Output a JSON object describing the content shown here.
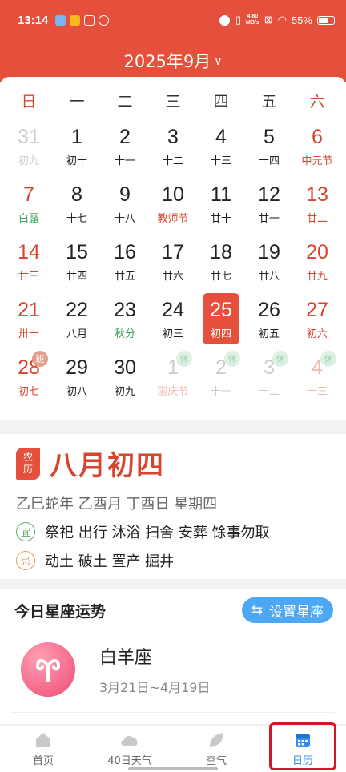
{
  "status_bar": {
    "time": "13:14",
    "net_speed_value": "4.80",
    "net_speed_unit": "MB/s",
    "battery": "55%"
  },
  "header": {
    "title": "2025年9月",
    "chevron_icon": "chevron-down-icon"
  },
  "weekdays": [
    "日",
    "一",
    "二",
    "三",
    "四",
    "五",
    "六"
  ],
  "calendar": {
    "selected": "25",
    "rows": [
      [
        {
          "d": "31",
          "l": "初九",
          "s": "dim"
        },
        {
          "d": "1",
          "l": "初十",
          "s": ""
        },
        {
          "d": "2",
          "l": "十一",
          "s": ""
        },
        {
          "d": "3",
          "l": "十二",
          "s": ""
        },
        {
          "d": "4",
          "l": "十三",
          "s": ""
        },
        {
          "d": "5",
          "l": "十四",
          "s": ""
        },
        {
          "d": "6",
          "l": "中元节",
          "s": "red"
        }
      ],
      [
        {
          "d": "7",
          "l": "白露",
          "s": "red-term"
        },
        {
          "d": "8",
          "l": "十七",
          "s": ""
        },
        {
          "d": "9",
          "l": "十八",
          "s": ""
        },
        {
          "d": "10",
          "l": "教师节",
          "s": "fest"
        },
        {
          "d": "11",
          "l": "廿十",
          "s": ""
        },
        {
          "d": "12",
          "l": "廿一",
          "s": ""
        },
        {
          "d": "13",
          "l": "廿二",
          "s": "red"
        }
      ],
      [
        {
          "d": "14",
          "l": "廿三",
          "s": "red"
        },
        {
          "d": "15",
          "l": "廿四",
          "s": ""
        },
        {
          "d": "16",
          "l": "廿五",
          "s": ""
        },
        {
          "d": "17",
          "l": "廿六",
          "s": ""
        },
        {
          "d": "18",
          "l": "廿七",
          "s": ""
        },
        {
          "d": "19",
          "l": "廿八",
          "s": ""
        },
        {
          "d": "20",
          "l": "廿九",
          "s": "red"
        }
      ],
      [
        {
          "d": "21",
          "l": "卅十",
          "s": "red"
        },
        {
          "d": "22",
          "l": "八月",
          "s": ""
        },
        {
          "d": "23",
          "l": "秋分",
          "s": "term"
        },
        {
          "d": "24",
          "l": "初三",
          "s": ""
        },
        {
          "d": "25",
          "l": "初四",
          "s": "selected"
        },
        {
          "d": "26",
          "l": "初五",
          "s": ""
        },
        {
          "d": "27",
          "l": "初六",
          "s": "red"
        }
      ],
      [
        {
          "d": "28",
          "l": "初七",
          "s": "red",
          "b": "班"
        },
        {
          "d": "29",
          "l": "初八",
          "s": ""
        },
        {
          "d": "30",
          "l": "初九",
          "s": ""
        },
        {
          "d": "1",
          "l": "国庆节",
          "s": "dimfest",
          "b": "休"
        },
        {
          "d": "2",
          "l": "十一",
          "s": "dim",
          "b": "休"
        },
        {
          "d": "3",
          "l": "十二",
          "s": "dim",
          "b": "休"
        },
        {
          "d": "4",
          "l": "十三",
          "s": "dimred",
          "b": "休"
        }
      ]
    ]
  },
  "lunar_info": {
    "tag": "农历",
    "date": "八月初四",
    "ganzhi": "乙巳蛇年 乙酉月 丁酉日 星期四",
    "yi_label": "宜",
    "yi": "祭祀 出行 沐浴 扫舍 安葬 馀事勿取",
    "ji_label": "忌",
    "ji": "动土 破土 置产 掘井"
  },
  "horoscope": {
    "title": "今日星座运势",
    "set_button": "设置星座",
    "sign_name": "白羊座",
    "sign_range": "3月21日~4月19日",
    "sign_icon": "aries-icon"
  },
  "tabs": [
    {
      "label": "首页",
      "icon": "home-icon",
      "active": false
    },
    {
      "label": "40日天气",
      "icon": "cloud-icon",
      "active": false
    },
    {
      "label": "空气",
      "icon": "leaf-icon",
      "active": false
    },
    {
      "label": "日历",
      "icon": "calendar-icon",
      "active": true
    }
  ],
  "colors": {
    "brand_red": "#e5503c",
    "accent_blue": "#2f8ef0",
    "term_green": "#3aa35a"
  }
}
